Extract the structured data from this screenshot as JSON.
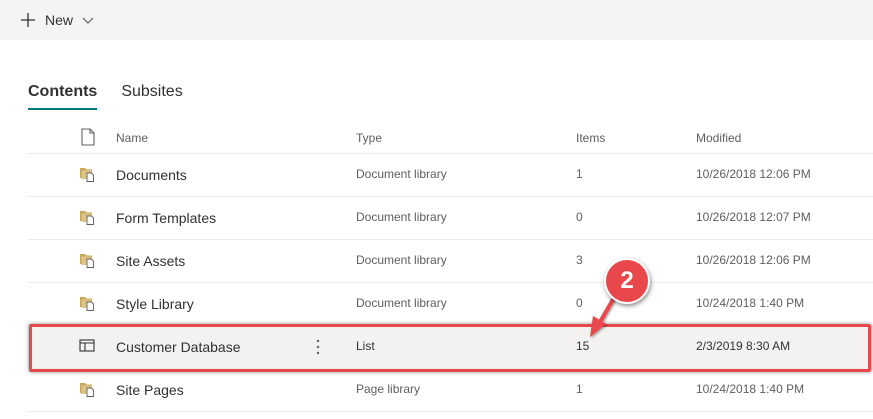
{
  "command_bar": {
    "new_label": "New",
    "icons": {
      "plus": "plus-icon",
      "chevron": "chevron-down-icon"
    }
  },
  "pivots": [
    {
      "label": "Contents",
      "selected": true
    },
    {
      "label": "Subsites",
      "selected": false
    }
  ],
  "table": {
    "columns": {
      "name": "Name",
      "type": "Type",
      "items": "Items",
      "modified": "Modified"
    },
    "rows": [
      {
        "name": "Documents",
        "type": "Document library",
        "items": "1",
        "modified": "10/26/2018 12:06 PM",
        "icon": "document-library-icon"
      },
      {
        "name": "Form Templates",
        "type": "Document library",
        "items": "0",
        "modified": "10/26/2018 12:07 PM",
        "icon": "document-library-icon"
      },
      {
        "name": "Site Assets",
        "type": "Document library",
        "items": "3",
        "modified": "10/26/2018 12:06 PM",
        "icon": "document-library-icon"
      },
      {
        "name": "Style Library",
        "type": "Document library",
        "items": "0",
        "modified": "10/24/2018 1:40 PM",
        "icon": "document-library-icon"
      },
      {
        "name": "Customer Database",
        "type": "List",
        "items": "15",
        "modified": "2/3/2019 8:30 AM",
        "icon": "list-icon",
        "selected": true
      },
      {
        "name": "Site Pages",
        "type": "Page library",
        "items": "1",
        "modified": "10/24/2018 1:40 PM",
        "icon": "document-library-icon"
      }
    ]
  },
  "annotation": {
    "callout_number": "2",
    "color": "#e8474c"
  },
  "colors": {
    "accent": "#03787c",
    "folder": "#c8a85a",
    "command_bar_bg": "#f4f4f4"
  }
}
